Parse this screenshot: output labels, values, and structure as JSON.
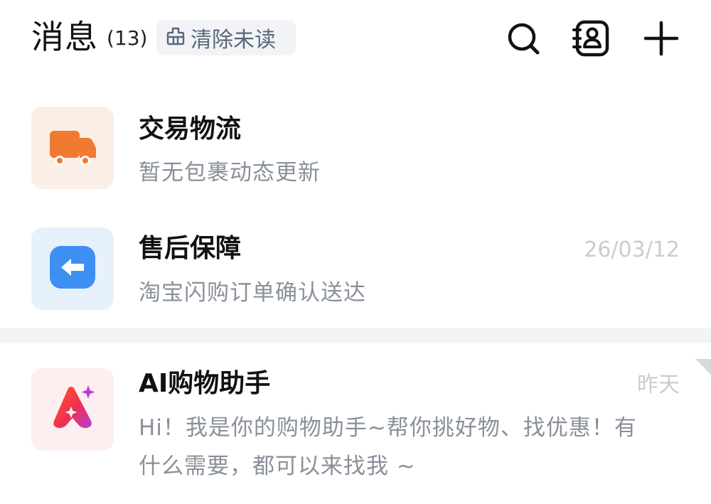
{
  "header": {
    "title": "消息",
    "count": "(13)",
    "clear_unread_label": "清除未读"
  },
  "messages": [
    {
      "name": "交易物流",
      "preview": "暂无包裹动态更新",
      "time": "",
      "icon": "truck-icon",
      "icon_bg": "#fbeee6",
      "icon_color": "#f07a32"
    },
    {
      "name": "售后保障",
      "preview": "淘宝闪购订单确认送达",
      "time": "26/03/12",
      "icon": "return-arrow-icon",
      "icon_bg": "#e7f1fc",
      "icon_color": "#3e8ff2"
    },
    {
      "name": "AI购物助手",
      "preview_line1": "Hi！我是你的购物助手~帮你挑好物、找优惠！有",
      "preview_line2": "什么需要，都可以来找我 ~",
      "time": "昨天",
      "icon": "ai-sparkle-icon",
      "icon_bg": "#fdeef0",
      "icon_color": "#f0503a"
    }
  ]
}
